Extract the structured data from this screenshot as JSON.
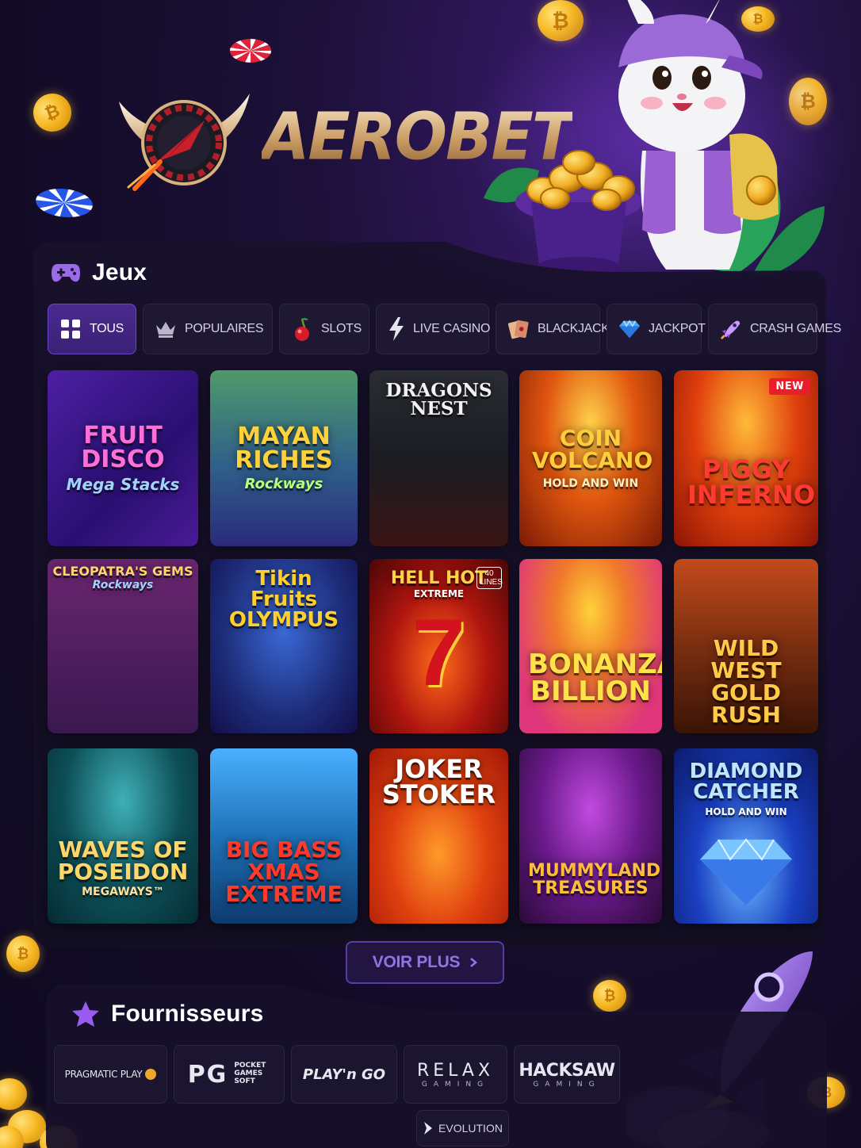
{
  "brand": {
    "name": "AEROBET"
  },
  "games_section": {
    "title": "Jeux",
    "icon": "gamepad-icon",
    "tabs": [
      {
        "label": "TOUS",
        "icon": "grid-icon",
        "active": true
      },
      {
        "label": "POPULAIRES",
        "icon": "crown-icon",
        "active": false
      },
      {
        "label": "SLOTS",
        "icon": "cherry-icon",
        "active": false
      },
      {
        "label": "LIVE CASINO",
        "icon": "lightning-icon",
        "active": false
      },
      {
        "label": "BLACKJACK",
        "icon": "cards-icon",
        "active": false
      },
      {
        "label": "JACKPOT",
        "icon": "diamond-icon",
        "active": false
      },
      {
        "label": "CRASH GAMES",
        "icon": "rocket-icon",
        "active": false
      }
    ],
    "games": [
      {
        "title": "FRUIT DISCO",
        "subtitle": "Mega Stacks",
        "theme": "#3b1a86"
      },
      {
        "title": "MAYAN RICHES",
        "subtitle": "Rockways",
        "theme": "#2a6b5a"
      },
      {
        "title": "DRAGONS NEST",
        "subtitle": "",
        "theme": "#1d1f26"
      },
      {
        "title": "COIN VOLCANO",
        "subtitle": "HOLD AND WIN",
        "theme": "#b8350f"
      },
      {
        "title": "PIGGY INFERNO",
        "subtitle": "",
        "theme": "#d23a0c",
        "badge": "NEW"
      },
      {
        "title": "CLEOPATRA'S GEMS",
        "subtitle": "Rockways",
        "theme": "#5a1f55"
      },
      {
        "title": "Tikin Fruits OLYMPUS",
        "subtitle": "",
        "theme": "#1d2c78"
      },
      {
        "title": "HELL HOT",
        "subtitle": "EXTREME",
        "extra": "40 LINES",
        "theme": "#8b0d0d"
      },
      {
        "title": "BONANZA BILLION",
        "subtitle": "",
        "theme": "#e0367a"
      },
      {
        "title": "WILD WEST GOLD RUSH",
        "subtitle": "",
        "theme": "#7a2e10"
      },
      {
        "title": "WAVES OF POSEIDON",
        "subtitle": "MEGAWAYS™",
        "theme": "#0d4f57"
      },
      {
        "title": "BIG BASS XMAS EXTREME",
        "subtitle": "",
        "theme": "#1f72b8"
      },
      {
        "title": "JOKER STOKER",
        "subtitle": "",
        "theme": "#d8400f"
      },
      {
        "title": "MUMMYLAND TREASURES",
        "subtitle": "",
        "theme": "#4a1560"
      },
      {
        "title": "DIAMOND CATCHER",
        "subtitle": "HOLD AND WIN",
        "theme": "#1a3fc0"
      }
    ],
    "more_button": "VOIR PLUS"
  },
  "providers_section": {
    "title": "Fournisseurs",
    "icon": "star-icon",
    "providers": [
      {
        "name": "PRAGMATIC PLAY"
      },
      {
        "name": "PG",
        "sub": "POCKET GAMES SOFT"
      },
      {
        "name": "PLAY'n GO"
      },
      {
        "name": "RELAX",
        "sub": "GAMING"
      },
      {
        "name": "HACKSAW",
        "sub": "GAMING"
      },
      {
        "name": "EVOLUTION"
      }
    ]
  },
  "colors": {
    "accent": "#6d45c9",
    "background": "#120b26",
    "gold": "#f7b925"
  }
}
